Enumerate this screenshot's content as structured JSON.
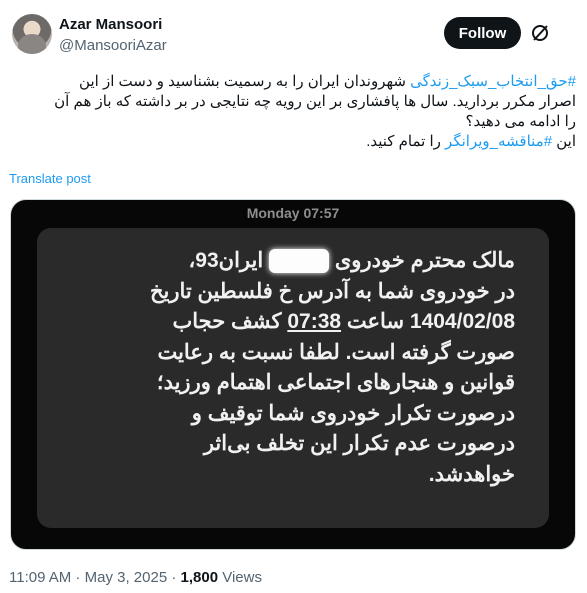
{
  "author": {
    "name": "Azar Mansoori",
    "handle": "@MansooriAzar"
  },
  "follow_label": "Follow",
  "post": {
    "line1_hashtag": "#حق_انتخاب_سبک_زندگی",
    "line1_text": " شهروندان ایران را به رسمیت بشناسید و دست از این",
    "line2": "اصرار مکرر بردارید. سال ها پافشاری بر این رویه چه نتایجی در بر داشته که باز هم آن",
    "line3": "را ادامه می دهید؟",
    "line4_prefix": "این ",
    "line4_hashtag": "#مناقشه_ویرانگر",
    "line4_suffix": " را تمام کنید."
  },
  "translate_label": "Translate post",
  "media": {
    "date_label": "Monday 07:57",
    "sms": {
      "l1a": "مالک محترم خودروی",
      "l1b": "ایران93،",
      "l2": "در خودروی شما به آدرس خ فلسطین تاریخ",
      "l3a": "1404/02/08 ساعت ",
      "l3b": "07:38",
      "l3c": " کشف حجاب",
      "l4": "صورت گرفته است. لطفا نسبت به رعایت",
      "l5": "قوانین و هنجارهای اجتماعی اهتمام ورزید؛",
      "l6": "درصورت تکرار خودروی شما توقیف و",
      "l7": "درصورت عدم تکرار این تخلف بی‌اثر",
      "l8": "خواهدشد."
    }
  },
  "footer": {
    "time": "11:09 AM",
    "sep1": " · ",
    "date": "May 3, 2025",
    "sep2": " · ",
    "views_count": "1,800",
    "views_label": " Views"
  },
  "icons": {
    "more": "grok-slash-circle-icon"
  },
  "colors": {
    "link": "#1d9bf0",
    "follow_bg": "#0f1419",
    "muted": "#536471"
  }
}
